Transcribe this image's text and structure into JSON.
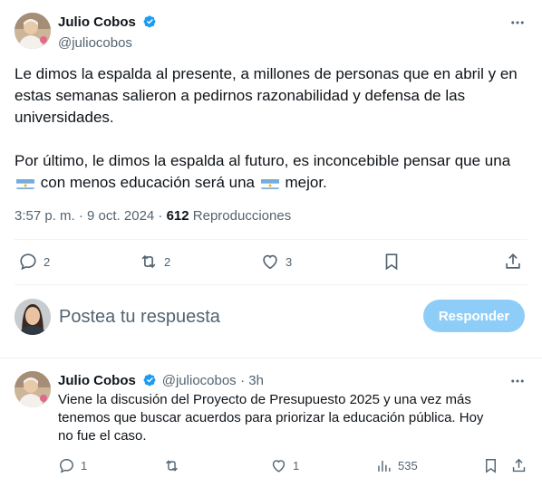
{
  "main_tweet": {
    "author_name": "Julio Cobos",
    "author_handle": "@juliocobos",
    "paragraph1": "Le dimos la espalda al presente, a millones de personas que en abril y en estas semanas salieron a pedirnos razonabilidad y defensa de las universidades.",
    "paragraph2_before_flag": "Por último, le dimos la espalda al futuro, es inconcebible pensar que una",
    "paragraph2_middle": "con menos educación será una",
    "paragraph2_end": "mejor.",
    "timestamp": "3:57 p. m. · 9 oct. 2024 · ",
    "views_count": "612",
    "views_label": " Reproducciones",
    "replies": "2",
    "retweets": "2",
    "likes": "3"
  },
  "composer": {
    "placeholder": "Postea tu respuesta",
    "reply_button": "Responder"
  },
  "reply_tweet": {
    "author_name": "Julio Cobos",
    "author_handle": "@juliocobos",
    "time": "· 3h",
    "text": "Viene la discusión del Proyecto de Presupuesto 2025 y una vez más tenemos que buscar acuerdos para priorizar la educación pública. Hoy no fue el caso.",
    "replies": "1",
    "likes": "1",
    "views": "535"
  },
  "colors": {
    "primary_text": "#0f1419",
    "secondary_text": "#536471",
    "verified_blue": "#1d9bf0",
    "reply_button_bg": "#8ecdf8",
    "divider": "#eff3f4",
    "flag_blue": "#74acdf"
  },
  "icons": [
    "verified-badge-icon",
    "more-icon",
    "reply-icon",
    "retweet-icon",
    "like-icon",
    "bookmark-icon",
    "share-icon",
    "views-icon",
    "argentina-flag-icon"
  ]
}
